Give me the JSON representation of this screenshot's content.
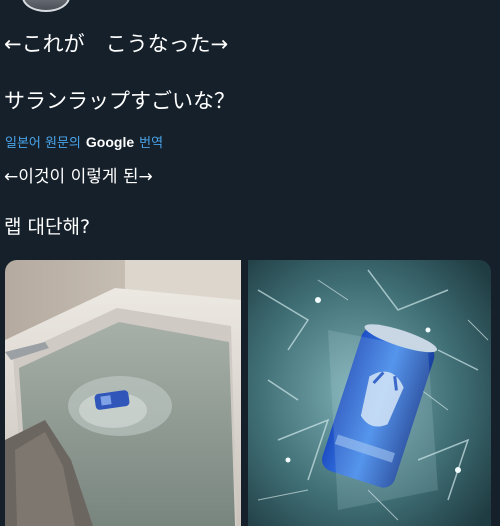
{
  "tweet": {
    "original_line1": "←これが　こうなった→",
    "original_line2": "サランラップすごいな？",
    "translate_label": "일본어 원문의",
    "translate_brand": "Google",
    "translate_action": "번역",
    "translated_line1": "←이것이 이렇게 된→",
    "translated_line2": "랩 대단해?"
  },
  "media": {
    "left_image": "bathtub-with-wrapped-can",
    "right_image": "can-wrapped-in-plastic"
  },
  "colors": {
    "background": "#15202b",
    "text": "#ffffff",
    "link": "#4aa3e8"
  }
}
